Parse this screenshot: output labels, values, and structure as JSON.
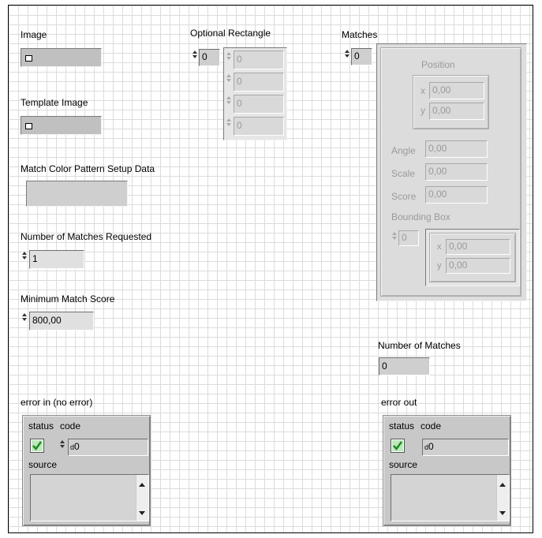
{
  "image": {
    "label": "Image"
  },
  "template_image": {
    "label": "Template Image"
  },
  "match_setup": {
    "label": "Match Color Pattern Setup Data"
  },
  "num_requested": {
    "label": "Number of Matches Requested",
    "value": "1"
  },
  "min_score": {
    "label": "Minimum Match Score",
    "value": "800,00"
  },
  "optional_rect": {
    "label": "Optional Rectangle",
    "index": "0",
    "values": [
      "0",
      "0",
      "0",
      "0"
    ]
  },
  "matches": {
    "label": "Matches",
    "index": "0",
    "position": {
      "label": "Position",
      "x_label": "x",
      "x": "0,00",
      "y_label": "y",
      "y": "0,00"
    },
    "angle": {
      "label": "Angle",
      "value": "0,00"
    },
    "scale": {
      "label": "Scale",
      "value": "0,00"
    },
    "score": {
      "label": "Score",
      "value": "0,00"
    },
    "bbox": {
      "label": "Bounding Box",
      "index": "0",
      "x_label": "x",
      "x": "0,00",
      "y_label": "y",
      "y": "0,00"
    }
  },
  "num_matches": {
    "label": "Number of Matches",
    "value": "0"
  },
  "error_in": {
    "label": "error in (no error)",
    "status_label": "status",
    "code_label": "code",
    "code_prefix": "d",
    "code": "0",
    "source_label": "source"
  },
  "error_out": {
    "label": "error out",
    "status_label": "status",
    "code_label": "code",
    "code_prefix": "d",
    "code": "0",
    "source_label": "source"
  },
  "colors": {
    "panel_grid": "#dcdcdc",
    "control_bg": "#c0c0c0",
    "disabled_text": "#9a9a9a",
    "check_green": "#2e9e2e"
  }
}
